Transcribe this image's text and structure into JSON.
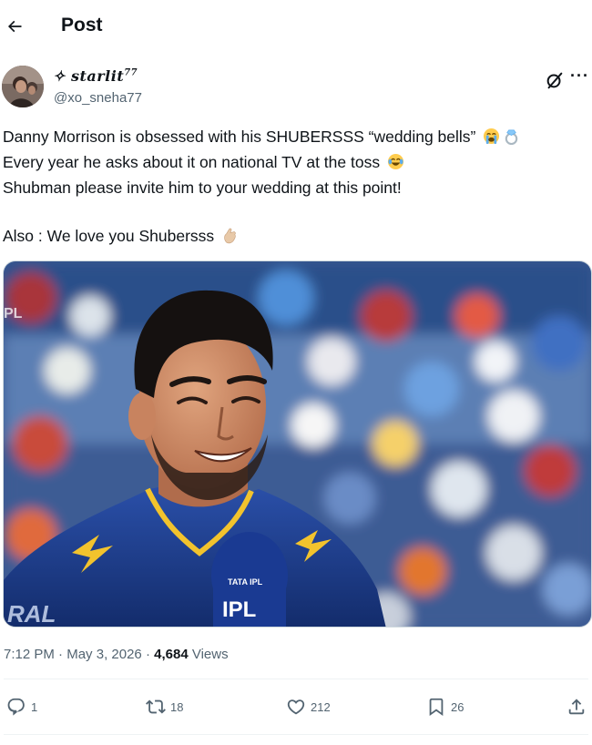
{
  "header": {
    "title": "Post"
  },
  "author": {
    "display_name": "✧ starlit",
    "display_name_suffix": "77",
    "handle": "@xo_sneha77"
  },
  "tweet": {
    "lines": [
      "Danny Morrison is obsessed with his SHUBERSSS “wedding bells”",
      "Every year he asks about it on national TV at the toss",
      "Shubman please invite him to your wedding at this point!",
      "Also : We love you Shubersss"
    ],
    "emojis": [
      "loudly-crying-face",
      "ring",
      "face-with-tears-of-joy",
      "pinching-hand"
    ]
  },
  "media": {
    "description_icon": "photo",
    "watermarks": [
      "PL",
      "RAL",
      "TATA IPL"
    ]
  },
  "meta": {
    "time": "7:12 PM",
    "separator": "·",
    "date": "May 3, 2026",
    "views_count": "4,684",
    "views_label": "Views"
  },
  "actions": {
    "replies": "1",
    "reposts": "18",
    "likes": "212",
    "bookmarks": "26"
  },
  "colors": {
    "text": "#0f1419",
    "secondary": "#536471",
    "divider": "#eff3f4",
    "jersey": "#1f3f8f",
    "jersey_trim": "#f2c32d"
  }
}
